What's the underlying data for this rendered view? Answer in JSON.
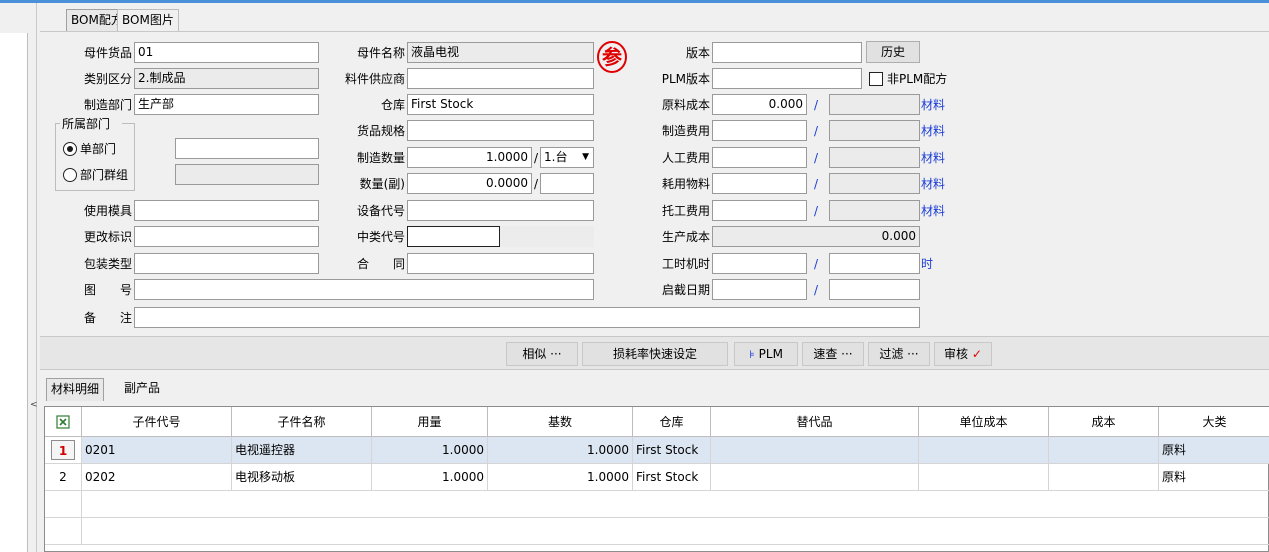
{
  "tabs": [
    "BOM配方",
    "BOM图片"
  ],
  "form": {
    "parent_code_label": "母件货品",
    "parent_code": "01",
    "category_label": "类别区分",
    "category": "2.制成品",
    "dept_label": "制造部门",
    "dept": "生产部",
    "belong_dept_label": "所属部门",
    "single_dept_label": "单部门",
    "dept_group_label": "部门群组",
    "mold_label": "使用模具",
    "change_label": "更改标识",
    "pack_label": "包装类型",
    "drawing_label": "图　　号",
    "remark_label": "备　　注",
    "parent_name_label": "母件名称",
    "parent_name": "液晶电视",
    "supplier_label": "料件供应商",
    "warehouse_label": "仓库",
    "warehouse": "First Stock",
    "spec_label": "货品规格",
    "qty_label": "制造数量",
    "qty": "1.0000",
    "qty_unit": "1.台",
    "qty_sub_label": "数量(副)",
    "qty_sub": "0.0000",
    "equip_label": "设备代号",
    "midclass_label": "中类代号",
    "contract_label": "合　　同",
    "seal_char": "参",
    "version_label": "版本",
    "history_btn": "历史",
    "plm_version_label": "PLM版本",
    "non_plm_label": "非PLM配方",
    "material_cost_label": "原料成本",
    "material_cost": "0.000",
    "mfg_cost_label": "制造费用",
    "labor_cost_label": "人工费用",
    "consume_label": "耗用物料",
    "outsource_label": "托工费用",
    "prod_cost_label": "生产成本",
    "prod_cost": "0.000",
    "work_hours_label": "工时机时",
    "start_date_label": "启截日期",
    "material_link": "材料",
    "hour_link": "时",
    "slash": "/"
  },
  "toolbar": {
    "similar": "相似 ···",
    "loss_rate": "损耗率快速设定",
    "plm": "PLM",
    "quick_search": "速查 ···",
    "filter": "过滤 ···",
    "audit": "审核",
    "audit_check": "✓"
  },
  "subtabs": [
    "材料明细",
    "副产品"
  ],
  "grid": {
    "headers": [
      "子件代号",
      "子件名称",
      "用量",
      "基数",
      "仓库",
      "替代品",
      "单位成本",
      "成本",
      "大类"
    ],
    "rows": [
      {
        "no": "1",
        "code": "0201",
        "name": "电视遥控器",
        "qty": "1.0000",
        "base": "1.0000",
        "wh": "First Stock",
        "sub": "",
        "unit_cost": "",
        "cost": "",
        "cat": "原料"
      },
      {
        "no": "2",
        "code": "0202",
        "name": "电视移动板",
        "qty": "1.0000",
        "base": "1.0000",
        "wh": "First Stock",
        "sub": "",
        "unit_cost": "",
        "cost": "",
        "cat": "原料"
      }
    ]
  },
  "colors": {
    "accent": "#4a90d9",
    "link": "#1b3cd6",
    "seal": "#e00000",
    "selected_row": "#dce6f2"
  }
}
